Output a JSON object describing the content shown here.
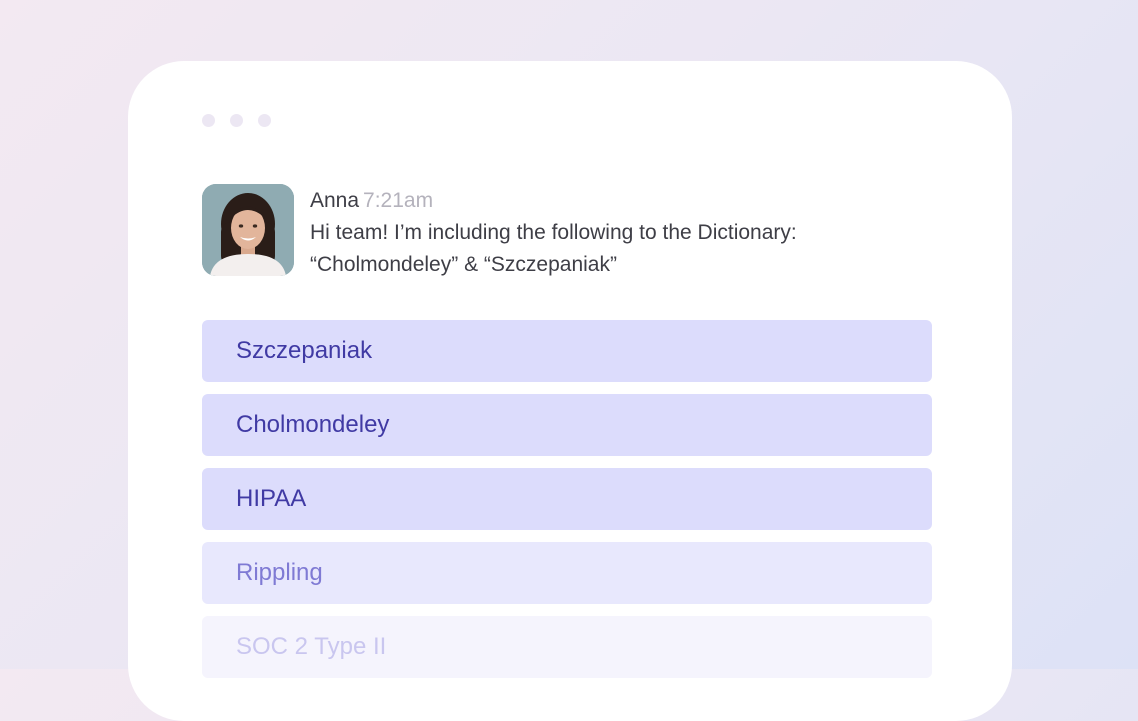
{
  "message": {
    "author": "Anna",
    "time": "7:21am",
    "line1": "Hi team! I’m including the following to the Dictionary:",
    "line2": "“Cholmondeley” & “Szczepaniak”"
  },
  "dictionary_items": [
    {
      "label": "Szczepaniak"
    },
    {
      "label": "Cholmondeley"
    },
    {
      "label": "HIPAA"
    },
    {
      "label": "Rippling"
    },
    {
      "label": "SOC 2 Type II"
    }
  ],
  "colors": {
    "item_bg_strong": "#dcdcfc",
    "item_text_strong": "#403aa4",
    "item_bg_medium": "#e8e8fd",
    "item_text_medium": "#7f7ad4",
    "item_bg_faded": "#f5f4fd",
    "item_text_faded": "#c9c6ef"
  }
}
